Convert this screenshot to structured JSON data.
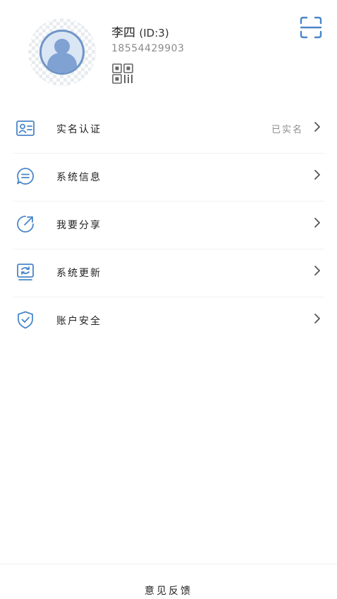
{
  "profile": {
    "name": "李四",
    "id_text": "(ID:3)",
    "phone": "18554429903"
  },
  "menu": {
    "items": [
      {
        "label": "实名认证",
        "right": "已实名",
        "icon": "id-card-icon"
      },
      {
        "label": "系统信息",
        "right": "",
        "icon": "message-icon"
      },
      {
        "label": "我要分享",
        "right": "",
        "icon": "share-icon"
      },
      {
        "label": "系统更新",
        "right": "",
        "icon": "update-icon"
      },
      {
        "label": "账户安全",
        "right": "",
        "icon": "shield-icon"
      }
    ]
  },
  "footer": {
    "feedback": "意见反馈"
  },
  "colors": {
    "accent": "#4a86c8",
    "chevron": "#555555"
  }
}
